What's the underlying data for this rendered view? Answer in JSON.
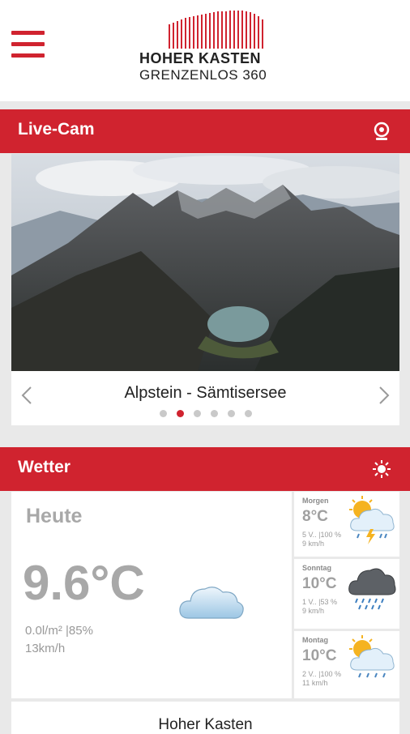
{
  "header": {
    "menu_icon": "hamburger-menu-icon",
    "logo_line1": "HOHER KASTEN",
    "logo_line2": "GRENZENLOS 360"
  },
  "livecam": {
    "title": "Live-Cam",
    "icon": "webcam-icon",
    "caption": "Alpstein - Sämtisersee",
    "dots_total": 6,
    "active_dot": 2
  },
  "weather": {
    "title": "Wetter",
    "icon": "sun-icon",
    "today": {
      "label": "Heute",
      "temp": "9.6°C",
      "details1": "0.0l/m² |85%",
      "details2": "13km/h",
      "icon": "cloud-icon"
    },
    "forecast": [
      {
        "day": "Morgen",
        "temp": "8°C",
        "details1": "5 V.. |100 %",
        "details2": "9 km/h",
        "icon": "sun-cloud-thunder-rain-icon"
      },
      {
        "day": "Sonntag",
        "temp": "10°C",
        "details1": "1 V.. |53 %",
        "details2": "9 km/h",
        "icon": "dark-cloud-rain-icon"
      },
      {
        "day": "Montag",
        "temp": "10°C",
        "details1": "2 V.. |100 %",
        "details2": "11 km/h",
        "icon": "sun-cloud-rain-icon"
      }
    ]
  },
  "location": {
    "name": "Hoher Kasten"
  },
  "colors": {
    "brand_red": "#d0232f",
    "background": "#e9e9e9"
  }
}
